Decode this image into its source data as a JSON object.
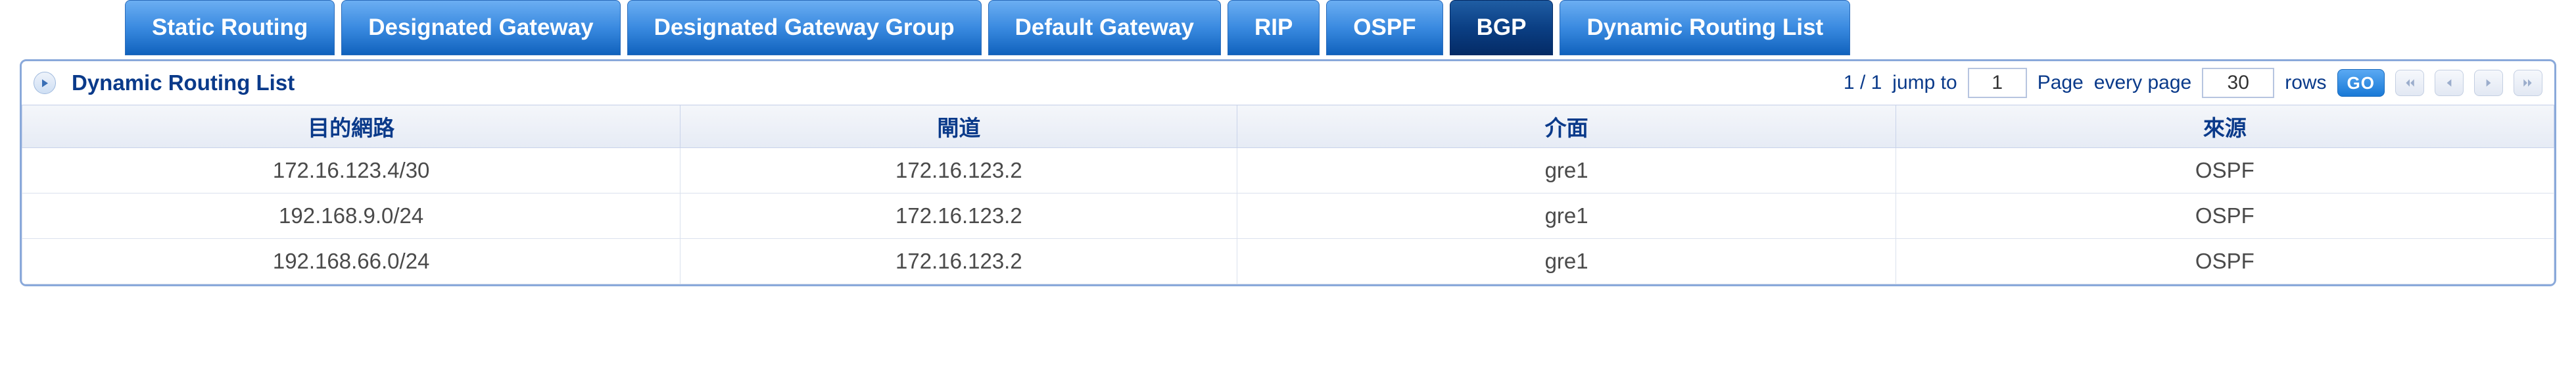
{
  "tabs": [
    {
      "label": "Static Routing",
      "active": false
    },
    {
      "label": "Designated Gateway",
      "active": false
    },
    {
      "label": "Designated Gateway Group",
      "active": false
    },
    {
      "label": "Default Gateway",
      "active": false
    },
    {
      "label": "RIP",
      "active": false
    },
    {
      "label": "OSPF",
      "active": false
    },
    {
      "label": "BGP",
      "active": true
    },
    {
      "label": "Dynamic Routing List",
      "active": false
    }
  ],
  "panel": {
    "title": "Dynamic Routing List"
  },
  "pager": {
    "count_text": "1 / 1",
    "jump_label": "jump to",
    "jump_value": "1",
    "page_label_prefix": "Page",
    "every_label": "every page",
    "rows_value": "30",
    "rows_label": "rows",
    "go_label": "GO"
  },
  "table": {
    "headers": {
      "dest": "目的網路",
      "gateway": "閘道",
      "iface": "介面",
      "source": "來源"
    },
    "rows": [
      {
        "dest": "172.16.123.4/30",
        "gateway": "172.16.123.2",
        "iface": "gre1",
        "source": "OSPF"
      },
      {
        "dest": "192.168.9.0/24",
        "gateway": "172.16.123.2",
        "iface": "gre1",
        "source": "OSPF"
      },
      {
        "dest": "192.168.66.0/24",
        "gateway": "172.16.123.2",
        "iface": "gre1",
        "source": "OSPF"
      }
    ]
  }
}
